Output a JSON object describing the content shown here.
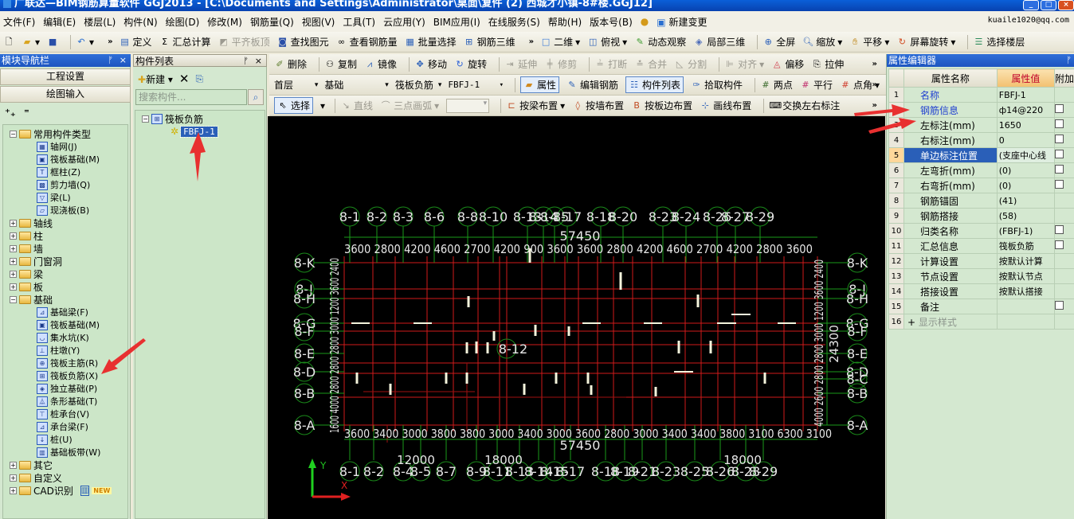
{
  "window": {
    "title": "广联达—BIM钢筋算量软件 GGJ2013 - [C:\\Documents and Settings\\Administrator\\桌面\\复件 (2) 西城才小镇-8#楼.GGJ12]",
    "user": "kuaile1020@qq.com"
  },
  "menu": [
    "文件(F)",
    "编辑(E)",
    "楼层(L)",
    "构件(N)",
    "绘图(D)",
    "修改(M)",
    "钢筋量(Q)",
    "视图(V)",
    "工具(T)",
    "云应用(Y)",
    "BIM应用(I)",
    "在线服务(S)",
    "帮助(H)",
    "版本号(B)",
    "新建变更"
  ],
  "toolbar_main": {
    "define": "定义",
    "calc": "汇总计算",
    "flush": "平齐板顶",
    "find": "查找图元",
    "view_rebar": "查看钢筋量",
    "batch": "批量选择",
    "rebar3d": "钢筋三维",
    "view2d": "二维",
    "top": "俯视",
    "orbit": "动态观察",
    "local3d": "局部三维",
    "fullscreen": "全屏",
    "zoom": "缩放",
    "pan": "平移",
    "rotate": "屏幕旋转",
    "floor": "选择楼层"
  },
  "nav": {
    "title": "模块导航栏",
    "btn_project": "工程设置",
    "btn_draw": "绘图输入",
    "tree": [
      {
        "label": "常用构件类型",
        "type": "folder",
        "open": true,
        "level": 0
      },
      {
        "label": "轴网(J)",
        "level": 1
      },
      {
        "label": "筏板基础(M)",
        "level": 1
      },
      {
        "label": "框柱(Z)",
        "level": 1
      },
      {
        "label": "剪力墙(Q)",
        "level": 1
      },
      {
        "label": "梁(L)",
        "level": 1
      },
      {
        "label": "现浇板(B)",
        "level": 1
      },
      {
        "label": "轴线",
        "type": "folder",
        "level": 0
      },
      {
        "label": "柱",
        "type": "folder",
        "level": 0
      },
      {
        "label": "墙",
        "type": "folder",
        "level": 0
      },
      {
        "label": "门窗洞",
        "type": "folder",
        "level": 0
      },
      {
        "label": "梁",
        "type": "folder",
        "level": 0
      },
      {
        "label": "板",
        "type": "folder",
        "level": 0
      },
      {
        "label": "基础",
        "type": "folder",
        "open": true,
        "level": 0
      },
      {
        "label": "基础梁(F)",
        "level": 1
      },
      {
        "label": "筏板基础(M)",
        "level": 1
      },
      {
        "label": "集水坑(K)",
        "level": 1
      },
      {
        "label": "柱墩(Y)",
        "level": 1
      },
      {
        "label": "筏板主筋(R)",
        "level": 1
      },
      {
        "label": "筏板负筋(X)",
        "level": 1
      },
      {
        "label": "独立基础(P)",
        "level": 1
      },
      {
        "label": "条形基础(T)",
        "level": 1
      },
      {
        "label": "桩承台(V)",
        "level": 1
      },
      {
        "label": "承台梁(F)",
        "level": 1
      },
      {
        "label": "桩(U)",
        "level": 1
      },
      {
        "label": "基础板带(W)",
        "level": 1
      },
      {
        "label": "其它",
        "type": "folder",
        "level": 0
      },
      {
        "label": "自定义",
        "type": "folder",
        "level": 0
      },
      {
        "label": "CAD识别",
        "type": "folder",
        "level": 0,
        "badge": "NEW"
      }
    ]
  },
  "complist": {
    "title": "构件列表",
    "new_label": "新建",
    "search_placeholder": "搜索构件...",
    "group": "筏板负筋",
    "item": "FBFJ-1"
  },
  "draw_toolbar1": {
    "delete": "删除",
    "copy": "复制",
    "mirror": "镜像",
    "move": "移动",
    "rotate": "旋转",
    "extend": "延伸",
    "trim": "修剪",
    "break": "打断",
    "merge": "合并",
    "split": "分割",
    "align": "对齐",
    "offset": "偏移",
    "stretch": "拉伸"
  },
  "draw_toolbar2": {
    "floor": "首层",
    "category": "基础",
    "type": "筏板负筋",
    "component": "FBFJ-1",
    "props": "属性",
    "edit_rebar": "编辑钢筋",
    "comp_list": "构件列表",
    "pick": "拾取构件",
    "two_point": "两点",
    "parallel": "平行",
    "point_angle": "点角"
  },
  "draw_toolbar3": {
    "select": "选择",
    "line": "直线",
    "arc": "三点画弧",
    "by_beam": "按梁布置",
    "by_wall": "按墙布置",
    "by_slab_edge": "按板边布置",
    "by_line": "画线布置",
    "swap": "交换左右标注"
  },
  "cad": {
    "top_axes": [
      "8-1",
      "8-2",
      "8-3",
      "8-6",
      "8-8",
      "8-10",
      "8-13",
      "8-14",
      "8-15",
      "8-17",
      "8-18",
      "8-20",
      "8-23",
      "8-24",
      "8-26",
      "8-27",
      "8-29"
    ],
    "bottom_axes": [
      "8-1",
      "8-2",
      "8-4",
      "8-5",
      "8-7",
      "8-9",
      "8-11",
      "8-13",
      "8-14",
      "8-15",
      "8-17",
      "8-18",
      "8-19",
      "8-21",
      "8-23",
      "8-25",
      "8-26",
      "8-28",
      "8-29"
    ],
    "left_axes": [
      "8-K",
      "8-J",
      "8-H",
      "8-G",
      "8-F",
      "8-E",
      "8-D",
      "8-B",
      "8-A"
    ],
    "right_axes": [
      "8-K",
      "8-J",
      "8-H",
      "8-G",
      "8-F",
      "8-E",
      "8-D",
      "8-C",
      "8-B",
      "8-A"
    ],
    "total_width": "57450",
    "top_dims": "3600 2800 4200 4600 2700 4200 900 3600 3600 2800 4200 4600 2700 4200 2800 3600",
    "bottom_dims": "3600 3400 3000 3800 3800 3000 3400 3000 3600 2800 3000 3400 3400 3800 3100 6300 3100",
    "bottom_sub1": "12000",
    "bottom_sub2": "18000",
    "bottom_sub3": "18000",
    "center_label": "8-12",
    "right_total": "24300",
    "ucs_y": "Y",
    "ucs_x": "X"
  },
  "props": {
    "title": "属性编辑器",
    "col_name": "属性名称",
    "col_value": "属性值",
    "col_extra": "附加",
    "rows": [
      {
        "n": "1",
        "name": "名称",
        "value": "FBFJ-1",
        "blue": true,
        "chk": false
      },
      {
        "n": "2",
        "name": "钢筋信息",
        "value": "ф14@220",
        "blue": true,
        "chk": true
      },
      {
        "n": "3",
        "name": "左标注(mm)",
        "value": "1650",
        "chk": true
      },
      {
        "n": "4",
        "name": "右标注(mm)",
        "value": "0",
        "chk": true
      },
      {
        "n": "5",
        "name": "单边标注位置",
        "value": "(支座中心线",
        "chk": true,
        "selected": true
      },
      {
        "n": "6",
        "name": "左弯折(mm)",
        "value": "(0)",
        "chk": true
      },
      {
        "n": "7",
        "name": "右弯折(mm)",
        "value": "(0)",
        "chk": true
      },
      {
        "n": "8",
        "name": "钢筋锚固",
        "value": "(41)",
        "chk": false
      },
      {
        "n": "9",
        "name": "钢筋搭接",
        "value": "(58)",
        "chk": false
      },
      {
        "n": "10",
        "name": "归类名称",
        "value": "(FBFJ-1)",
        "chk": true
      },
      {
        "n": "11",
        "name": "汇总信息",
        "value": "筏板负筋",
        "chk": true
      },
      {
        "n": "12",
        "name": "计算设置",
        "value": "按默认计算",
        "chk": false
      },
      {
        "n": "13",
        "name": "节点设置",
        "value": "按默认节点",
        "chk": false
      },
      {
        "n": "14",
        "name": "搭接设置",
        "value": "按默认搭接",
        "chk": false
      },
      {
        "n": "15",
        "name": "备注",
        "value": "",
        "chk": true
      },
      {
        "n": "16",
        "name": "显示样式",
        "value": "",
        "chk": false,
        "expand": true,
        "gray": true
      }
    ]
  }
}
